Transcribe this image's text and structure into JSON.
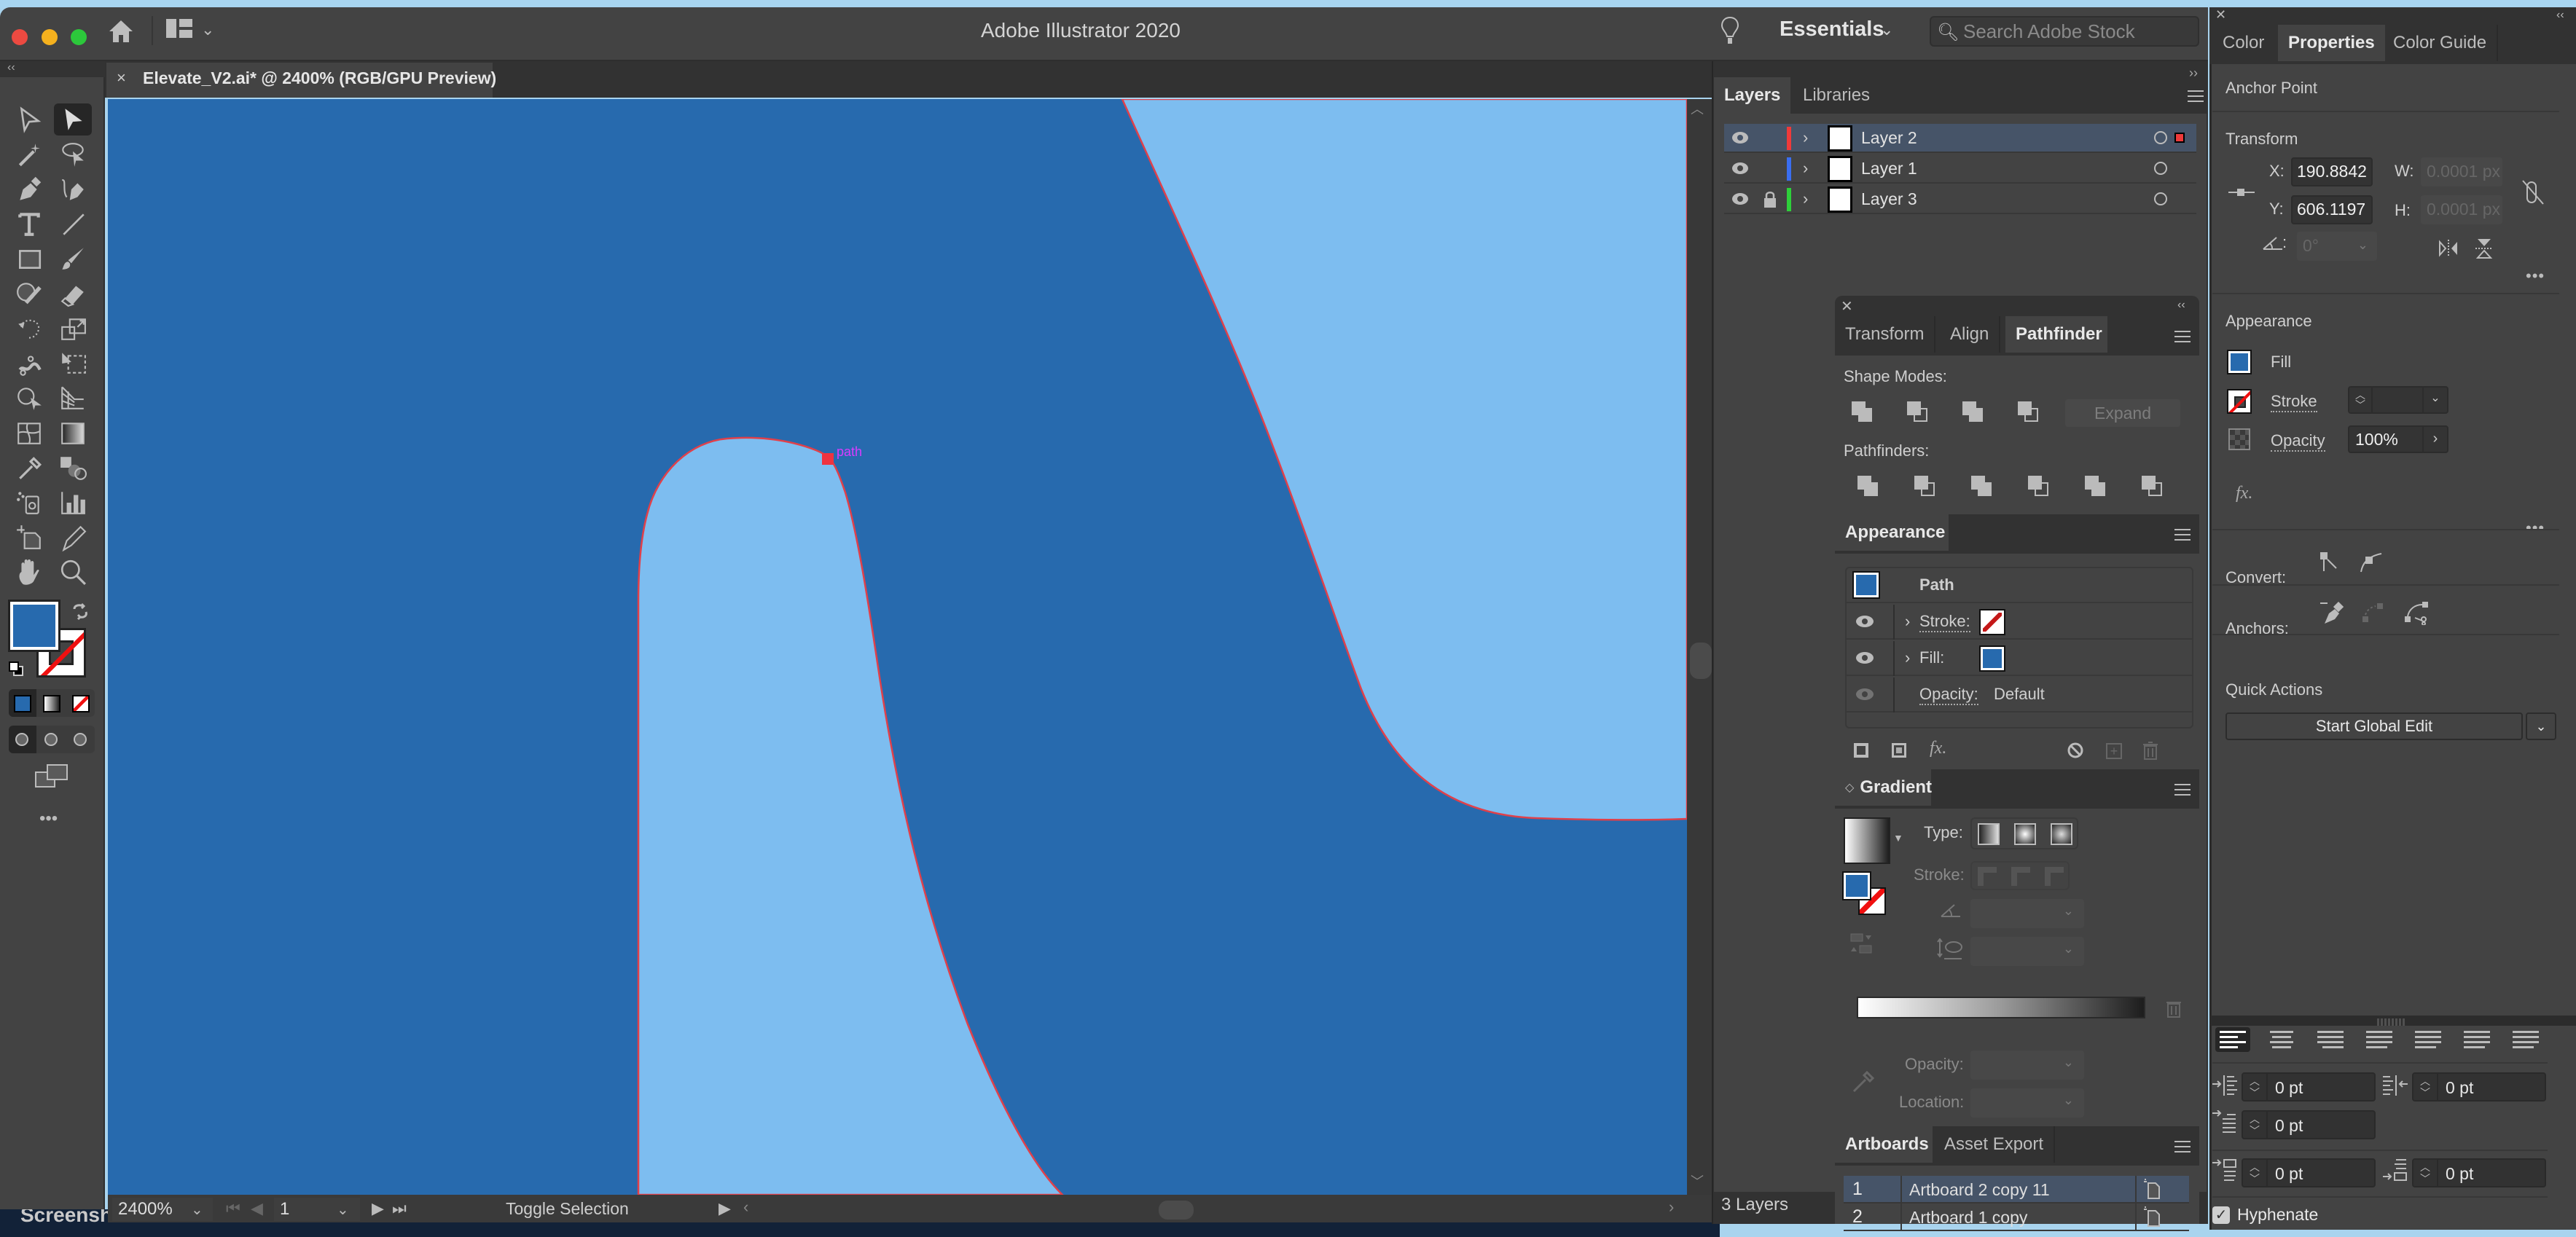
{
  "window": {
    "app_title": "Adobe Illustrator 2020",
    "workspace": "Essentials",
    "stock_search_placeholder": "Search Adobe Stock"
  },
  "document": {
    "tab_title": "Elevate_V2.ai* @ 2400% (RGB/GPU Preview)",
    "close_glyph": "×",
    "canvas": {
      "dark_fill": "#276aae",
      "light_fill": "#7dbdf0",
      "stroke_color": "#e0404a",
      "anchor_label": "path",
      "anchor_label_color": "#d93cff"
    }
  },
  "toolbar": {
    "collapse_glyph": "‹‹",
    "tools": [
      {
        "name": "selection-tool",
        "active": false
      },
      {
        "name": "direct-selection-tool",
        "active": true
      },
      {
        "name": "magic-wand-tool",
        "active": false
      },
      {
        "name": "lasso-tool",
        "active": false
      },
      {
        "name": "pen-tool",
        "active": false
      },
      {
        "name": "curvature-tool",
        "active": false
      },
      {
        "name": "type-tool",
        "active": false
      },
      {
        "name": "line-segment-tool",
        "active": false
      },
      {
        "name": "rectangle-tool",
        "active": false
      },
      {
        "name": "paintbrush-tool",
        "active": false
      },
      {
        "name": "shaper-tool",
        "active": false
      },
      {
        "name": "eraser-tool",
        "active": false
      },
      {
        "name": "rotate-tool",
        "active": false
      },
      {
        "name": "scale-tool",
        "active": false
      },
      {
        "name": "puppet-warp-tool",
        "active": false
      },
      {
        "name": "free-transform-tool",
        "active": false
      },
      {
        "name": "shape-builder-tool",
        "active": false
      },
      {
        "name": "perspective-grid-tool",
        "active": false
      },
      {
        "name": "mesh-tool",
        "active": false
      },
      {
        "name": "gradient-tool",
        "active": false
      },
      {
        "name": "eyedropper-tool",
        "active": false
      },
      {
        "name": "blend-tool",
        "active": false
      },
      {
        "name": "symbol-sprayer-tool",
        "active": false
      },
      {
        "name": "column-graph-tool",
        "active": false
      },
      {
        "name": "artboard-tool",
        "active": false
      },
      {
        "name": "slice-tool",
        "active": false
      },
      {
        "name": "hand-tool",
        "active": false
      },
      {
        "name": "zoom-tool",
        "active": false
      }
    ],
    "fill_color": "#276aae",
    "more_glyph": "•••"
  },
  "status": {
    "zoom": "2400%",
    "artboard_number": "1",
    "status_text": "Toggle Selection"
  },
  "layers": {
    "tabs": [
      "Layers",
      "Libraries"
    ],
    "active_tab": "Layers",
    "rows": [
      {
        "name": "Layer 2",
        "color": "#ef3a3a",
        "locked": false,
        "selected": true,
        "visible": true
      },
      {
        "name": "Layer 1",
        "color": "#3a6ef0",
        "locked": false,
        "selected": false,
        "visible": true
      },
      {
        "name": "Layer 3",
        "color": "#2ed03a",
        "locked": true,
        "selected": false,
        "visible": true
      }
    ],
    "count_label": "3 Layers"
  },
  "pathfinder": {
    "tabs": [
      "Transform",
      "Align",
      "Pathfinder"
    ],
    "active_tab": "Pathfinder",
    "shape_modes_label": "Shape Modes:",
    "pathfinders_label": "Pathfinders:",
    "expand_label": "Expand",
    "shape_modes": [
      "unite",
      "minus-front",
      "intersect",
      "exclude"
    ],
    "pathfinder_ops": [
      "divide",
      "trim",
      "merge",
      "crop",
      "outline",
      "minus-back"
    ]
  },
  "appearance": {
    "tab": "Appearance",
    "object_label": "Path",
    "stroke_label": "Stroke:",
    "fill_label": "Fill:",
    "opacity_label": "Opacity:",
    "opacity_value": "Default",
    "fill_color": "#276aae"
  },
  "gradient": {
    "tab": "Gradient",
    "type_label": "Type:",
    "stroke_label": "Stroke:",
    "opacity_label": "Opacity:",
    "location_label": "Location:"
  },
  "artboards": {
    "tabs": [
      "Artboards",
      "Asset Export"
    ],
    "active_tab": "Artboards",
    "rows": [
      {
        "num": "1",
        "name": "Artboard 2 copy 11",
        "selected": true
      },
      {
        "num": "2",
        "name": "Artboard 1 copy",
        "selected": false
      }
    ]
  },
  "properties": {
    "tabs": [
      "Color",
      "Properties",
      "Color Guide"
    ],
    "active_tab": "Properties",
    "selection_type": "Anchor Point",
    "transform": {
      "title": "Transform",
      "x_label": "X:",
      "x": "190.8842",
      "y_label": "Y:",
      "y": "606.1197",
      "w_label": "W:",
      "w": "0.0001 px",
      "h_label": "H:",
      "h": "0.0001 px",
      "angle": "0°"
    },
    "appearance": {
      "title": "Appearance",
      "fill_label": "Fill",
      "stroke_label": "Stroke",
      "opacity_label": "Opacity",
      "opacity_value": "100%",
      "fx_label": "fx."
    },
    "convert_label": "Convert:",
    "anchors_label": "Anchors:",
    "quick_actions": {
      "title": "Quick Actions",
      "button": "Start Global Edit"
    },
    "paragraph": {
      "left_indent": "0 pt",
      "right_indent": "0 pt",
      "first_line_indent": "0 pt",
      "space_before": "0 pt",
      "space_after": "0 pt",
      "hyphenate_label": "Hyphenate",
      "hyphenate": true
    }
  },
  "desktop": {
    "folder_label": "Screenshots"
  }
}
